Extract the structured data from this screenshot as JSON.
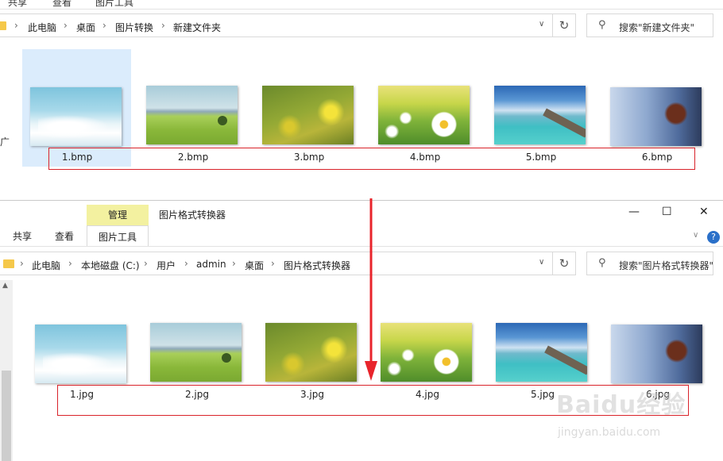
{
  "top_window": {
    "ribbon_tabs": [
      "共享",
      "查看",
      "图片工具"
    ],
    "breadcrumb": [
      "此电脑",
      "桌面",
      "图片转换",
      "新建文件夹"
    ],
    "search_placeholder": "搜索\"新建文件夹\"",
    "side_label": "广",
    "files": [
      {
        "name": "1.bmp",
        "image": "sky-clouds",
        "selected": true
      },
      {
        "name": "2.bmp",
        "image": "green-field"
      },
      {
        "name": "3.bmp",
        "image": "rapeseed-flowers"
      },
      {
        "name": "4.bmp",
        "image": "daisy-meadow"
      },
      {
        "name": "5.bmp",
        "image": "sea-pier"
      },
      {
        "name": "6.bmp",
        "image": "lake-boathouse"
      }
    ]
  },
  "bottom_window": {
    "context_tab": "管理",
    "title": "图片格式转换器",
    "ribbon_tabs": [
      "共享",
      "查看",
      "图片工具"
    ],
    "breadcrumb": [
      "此电脑",
      "本地磁盘 (C:)",
      "用户",
      "admin",
      "桌面",
      "图片格式转换器"
    ],
    "search_placeholder": "搜索\"图片格式转换器\"",
    "window_controls": {
      "minimize": "—",
      "maximize": "☐",
      "close": "✕"
    },
    "help": "?",
    "files": [
      {
        "name": "1.jpg",
        "image": "sky-clouds"
      },
      {
        "name": "2.jpg",
        "image": "green-field"
      },
      {
        "name": "3.jpg",
        "image": "rapeseed-flowers"
      },
      {
        "name": "4.jpg",
        "image": "daisy-meadow"
      },
      {
        "name": "5.jpg",
        "image": "sea-pier"
      },
      {
        "name": "6.jpg",
        "image": "lake-boathouse"
      }
    ]
  },
  "icons": {
    "refresh": "↻",
    "search": "⚲",
    "chevron": "∨",
    "separator": "›",
    "scroll_up": "▲"
  },
  "colors": {
    "highlight_box": "#d9232a",
    "arrow": "#e8242b",
    "manage_tab": "#f3f1a0",
    "selection": "#dbecfc"
  },
  "watermark": {
    "brand": "Baidu经验",
    "url": "jingyan.baidu.com"
  }
}
